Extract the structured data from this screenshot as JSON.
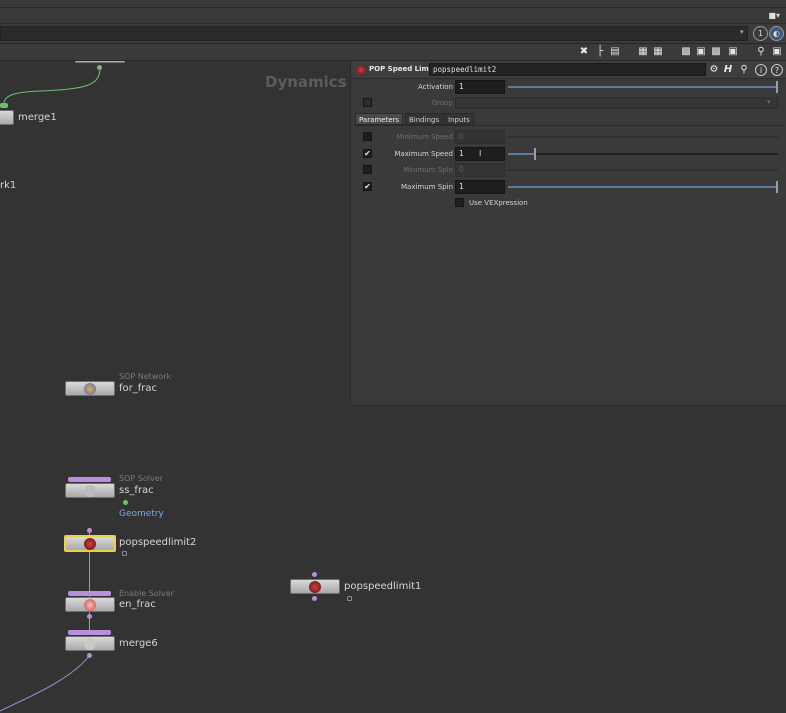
{
  "network": {
    "context_label": "Dynamics",
    "nodes": {
      "top_partial_label": "rk1",
      "merge1": "merge1",
      "sop_network_type": "SOP Network",
      "for_frac": "for_frac",
      "sop_solver_type": "SOP Solver",
      "ss_frac": "ss_frac",
      "ss_frac_output": "Geometry",
      "popspeedlimit2": "popspeedlimit2",
      "enable_solver_type": "Enable Solver",
      "en_frac": "en_frac",
      "merge6": "merge6",
      "popspeedlimit1": "popspeedlimit1"
    }
  },
  "toolbar": {
    "circle_label": "1"
  },
  "params": {
    "node_type": "POP Speed Limit",
    "node_name": "popspeedlimit2",
    "activation_label": "Activation",
    "activation_value": "1",
    "group_label": "Group",
    "tabs": [
      "Parameters",
      "Bindings",
      "Inputs"
    ],
    "min_speed_label": "Minimum Speed",
    "min_speed_value": "0",
    "max_speed_label": "Maximum Speed",
    "max_speed_value": "1",
    "min_spin_label": "Minimum Spin",
    "min_spin_value": "0",
    "max_spin_label": "Maximum Spin",
    "max_spin_value": "1",
    "use_vex_label": "Use VEXpression",
    "checks": {
      "min_speed": false,
      "max_speed": true,
      "min_spin": false,
      "max_spin": true,
      "use_vex": false
    },
    "max_speed_slider_fraction": 0.1
  },
  "colors": {
    "selected_node": "#e6d14a",
    "flag": "#b88fdc",
    "slider_fill": "#5d7aa5",
    "geometry_label": "#7fa6e0"
  }
}
